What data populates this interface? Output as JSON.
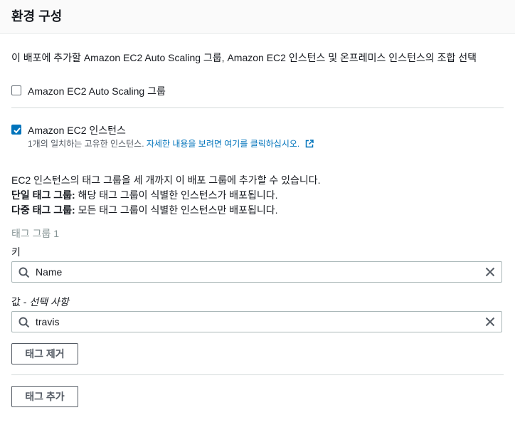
{
  "header": {
    "title": "환경 구성"
  },
  "description": "이 배포에 추가할 Amazon EC2 Auto Scaling 그룹, Amazon EC2 인스턴스 및 온프레미스 인스턴스의 조합 선택",
  "options": {
    "auto_scaling": {
      "label": "Amazon EC2 Auto Scaling 그룹",
      "checked": false
    },
    "ec2": {
      "label": "Amazon EC2 인스턴스",
      "checked": true,
      "sub_text": "1개의 일치하는 고유한 인스턴스.",
      "sub_link": "자세한 내용을 보려면 여기를 클릭하십시오."
    }
  },
  "info": {
    "line1": "EC2 인스턴스의 태그 그룹을 세 개까지 이 배포 그룹에 추가할 수 있습니다.",
    "line2_bold": "단일 태그 그룹:",
    "line2_text": " 해당 태그 그룹이 식별한 인스턴스가 배포됩니다.",
    "line3_bold": "다중 태그 그룹:",
    "line3_text": " 모든 태그 그룹이 식별한 인스턴스만 배포됩니다."
  },
  "tag_group": {
    "title": "태그 그룹 1",
    "key_label": "키",
    "key_value": "Name",
    "value_label": "값 - ",
    "value_optional": "선택 사항",
    "value_value": "travis",
    "remove_button": "태그 제거"
  },
  "add_button": "태그 추가",
  "colors": {
    "accent": "#0073bb",
    "text": "#16191f",
    "muted": "#879596",
    "border": "#aab7b8"
  },
  "icons": {
    "search": "search-icon",
    "clear": "close-icon",
    "external": "external-link-icon",
    "check": "check-icon"
  }
}
